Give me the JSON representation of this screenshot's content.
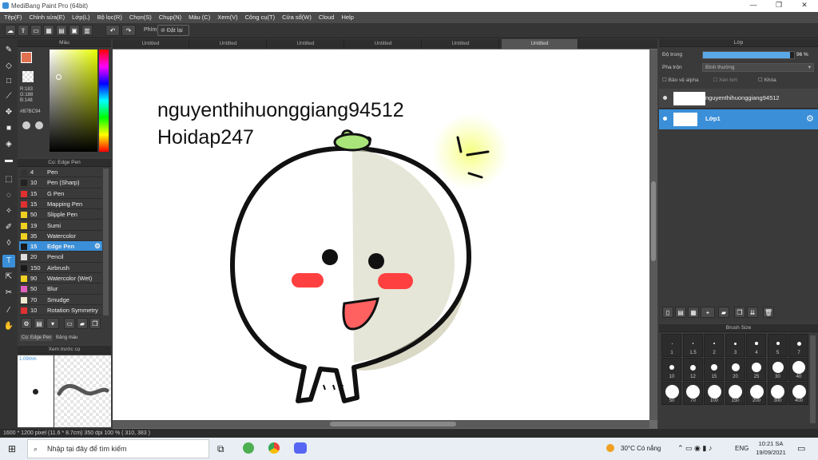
{
  "app": {
    "title": "MediBang Paint Pro (64bit)"
  },
  "menu": [
    "Tệp(F)",
    "Chỉnh sửa(E)",
    "Lớp(L)",
    "Bộ lọc(R)",
    "Chọn(S)",
    "Chụp(N)",
    "Màu (C)",
    "Xem(V)",
    "Công cụ(T)",
    "Cửa sổ(W)",
    "Cloud",
    "Help"
  ],
  "toolbar": {
    "key_label": "Phím",
    "reset_label": "Đặt lại"
  },
  "color_panel": {
    "title": "Màu",
    "r": "R:183",
    "g": "G:188",
    "b": "B:148",
    "hex": "#B7BC94"
  },
  "brush_panel": {
    "title": "Cọ: Edge Pen",
    "items": [
      {
        "size": "4",
        "name": "Pen",
        "color": "#333333"
      },
      {
        "size": "10",
        "name": "Pen (Sharp)",
        "color": "#222222"
      },
      {
        "size": "15",
        "name": "G Pen",
        "color": "#e03030"
      },
      {
        "size": "15",
        "name": "Mapping Pen",
        "color": "#e03030"
      },
      {
        "size": "50",
        "name": "Slipple Pen",
        "color": "#f0d020"
      },
      {
        "size": "19",
        "name": "Sumi",
        "color": "#f0d020"
      },
      {
        "size": "35",
        "name": "Watercolor",
        "color": "#f0d020"
      },
      {
        "size": "15",
        "name": "Edge Pen",
        "color": "#1a1a1a"
      },
      {
        "size": "20",
        "name": "Pencil",
        "color": "#dddddd"
      },
      {
        "size": "150",
        "name": "Airbrush",
        "color": "#1a1a1a"
      },
      {
        "size": "90",
        "name": "Watercolor (Wet)",
        "color": "#f0d020"
      },
      {
        "size": "50",
        "name": "Blur",
        "color": "#e060c0"
      },
      {
        "size": "70",
        "name": "Smudge",
        "color": "#f0e8d0"
      },
      {
        "size": "10",
        "name": "Rotation Symmetry",
        "color": "#e03030"
      }
    ],
    "tab1": "Cọ: Edge Pen",
    "tab2": "Bảng màu"
  },
  "preview": {
    "title": "Xem trước cọ",
    "size": "1.09mm"
  },
  "tabs": [
    "Untitled",
    "Untitled",
    "Untitled",
    "Untitled",
    "Untitled",
    "Untitled"
  ],
  "canvas_text": {
    "line1": "nguyenthihuonggiang94512",
    "line2": "Hoidap247"
  },
  "layer_panel": {
    "title": "Lớp",
    "opacity_label": "Độ trong",
    "opacity_value": "96 %",
    "opacity": 0.96,
    "blend_label": "Pha trộn",
    "blend_value": "Bình thường",
    "protect": "Bảo vệ alpha",
    "clip": "Xén bớt",
    "lock": "Khóa",
    "layers": [
      {
        "name": "nguyenthihuonggiang94512"
      },
      {
        "name": "Lớp1"
      }
    ]
  },
  "brush_size": {
    "title": "Brush Size",
    "labels": [
      "1",
      "1.5",
      "2",
      "3",
      "4",
      "5",
      "7",
      "10",
      "12",
      "15",
      "20",
      "25",
      "30",
      "40",
      "50",
      "70",
      "100",
      "150",
      "200",
      "300",
      "400"
    ]
  },
  "status": {
    "text": "1600 * 1200 pixel   (11.6 * 8.7cm)   350 dpi   100 %   ( 310, 383 )"
  },
  "taskbar": {
    "search": "Nhập tại đây để tìm kiếm",
    "weather": "30°C  Có nắng",
    "lang": "ENG",
    "time": "10:21 SA",
    "date": "19/09/2021"
  }
}
